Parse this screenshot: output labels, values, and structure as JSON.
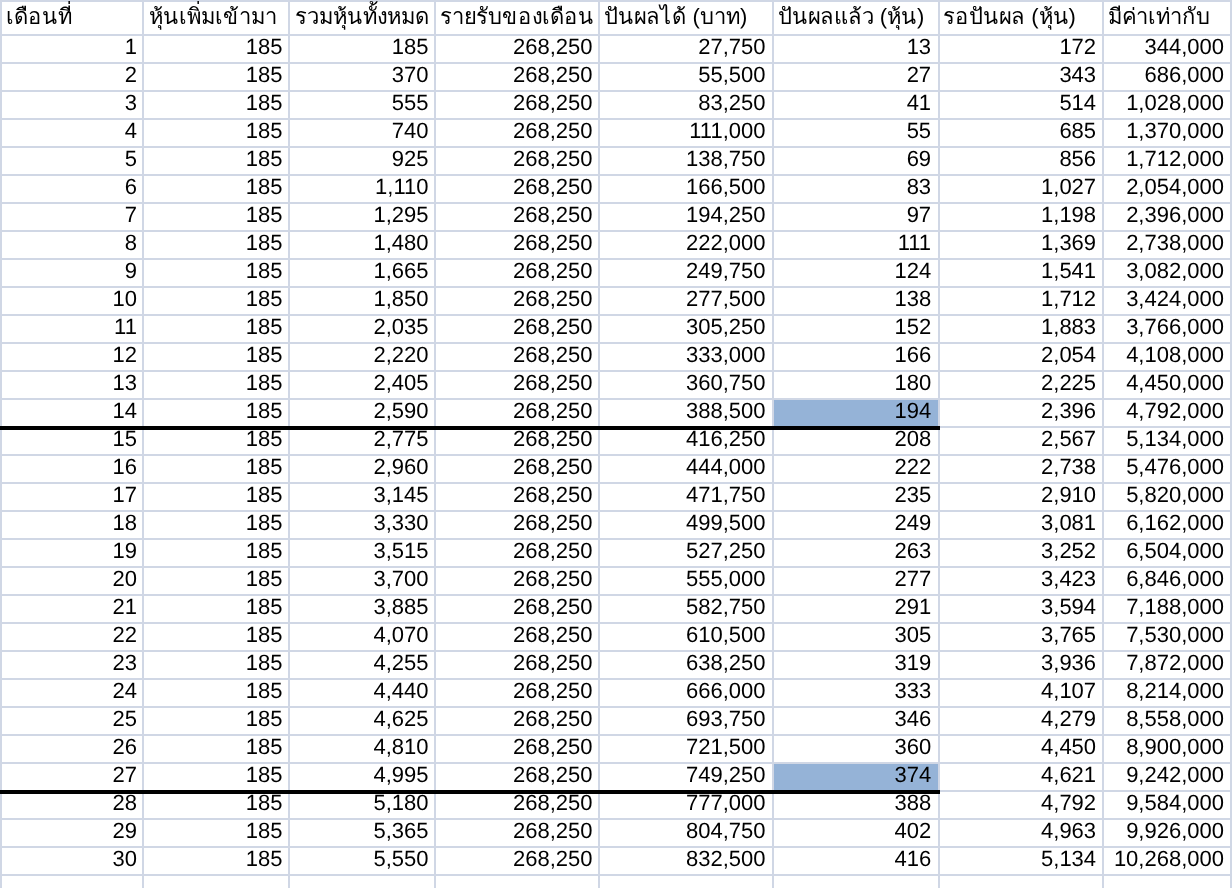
{
  "columns": [
    "เดือนที่",
    "หุ้นเพิ่มเข้ามา",
    "รวมหุ้นทั้งหมด",
    "รายรับของเดือน",
    "ปันผลได้ (บาท)",
    "ปันผลแล้ว (หุ้น)",
    "รอปันผล (หุ้น)",
    "มีค่าเท่ากับ"
  ],
  "rows": [
    {
      "cells": [
        "1",
        "185",
        "185",
        "268,250",
        "27,750",
        "13",
        "172",
        "344,000"
      ],
      "selected": false,
      "thick_border_below": false
    },
    {
      "cells": [
        "2",
        "185",
        "370",
        "268,250",
        "55,500",
        "27",
        "343",
        "686,000"
      ],
      "selected": false,
      "thick_border_below": false
    },
    {
      "cells": [
        "3",
        "185",
        "555",
        "268,250",
        "83,250",
        "41",
        "514",
        "1,028,000"
      ],
      "selected": false,
      "thick_border_below": false
    },
    {
      "cells": [
        "4",
        "185",
        "740",
        "268,250",
        "111,000",
        "55",
        "685",
        "1,370,000"
      ],
      "selected": false,
      "thick_border_below": false
    },
    {
      "cells": [
        "5",
        "185",
        "925",
        "268,250",
        "138,750",
        "69",
        "856",
        "1,712,000"
      ],
      "selected": false,
      "thick_border_below": false
    },
    {
      "cells": [
        "6",
        "185",
        "1,110",
        "268,250",
        "166,500",
        "83",
        "1,027",
        "2,054,000"
      ],
      "selected": false,
      "thick_border_below": false
    },
    {
      "cells": [
        "7",
        "185",
        "1,295",
        "268,250",
        "194,250",
        "97",
        "1,198",
        "2,396,000"
      ],
      "selected": false,
      "thick_border_below": false
    },
    {
      "cells": [
        "8",
        "185",
        "1,480",
        "268,250",
        "222,000",
        "111",
        "1,369",
        "2,738,000"
      ],
      "selected": false,
      "thick_border_below": false
    },
    {
      "cells": [
        "9",
        "185",
        "1,665",
        "268,250",
        "249,750",
        "124",
        "1,541",
        "3,082,000"
      ],
      "selected": false,
      "thick_border_below": false
    },
    {
      "cells": [
        "10",
        "185",
        "1,850",
        "268,250",
        "277,500",
        "138",
        "1,712",
        "3,424,000"
      ],
      "selected": false,
      "thick_border_below": false
    },
    {
      "cells": [
        "11",
        "185",
        "2,035",
        "268,250",
        "305,250",
        "152",
        "1,883",
        "3,766,000"
      ],
      "selected": false,
      "thick_border_below": false
    },
    {
      "cells": [
        "12",
        "185",
        "2,220",
        "268,250",
        "333,000",
        "166",
        "2,054",
        "4,108,000"
      ],
      "selected": false,
      "thick_border_below": false
    },
    {
      "cells": [
        "13",
        "185",
        "2,405",
        "268,250",
        "360,750",
        "180",
        "2,225",
        "4,450,000"
      ],
      "selected": false,
      "thick_border_below": false
    },
    {
      "cells": [
        "14",
        "185",
        "2,590",
        "268,250",
        "388,500",
        "194",
        "2,396",
        "4,792,000"
      ],
      "selected": true,
      "thick_border_below": true
    },
    {
      "cells": [
        "15",
        "185",
        "2,775",
        "268,250",
        "416,250",
        "208",
        "2,567",
        "5,134,000"
      ],
      "selected": false,
      "thick_border_below": false
    },
    {
      "cells": [
        "16",
        "185",
        "2,960",
        "268,250",
        "444,000",
        "222",
        "2,738",
        "5,476,000"
      ],
      "selected": false,
      "thick_border_below": false
    },
    {
      "cells": [
        "17",
        "185",
        "3,145",
        "268,250",
        "471,750",
        "235",
        "2,910",
        "5,820,000"
      ],
      "selected": false,
      "thick_border_below": false
    },
    {
      "cells": [
        "18",
        "185",
        "3,330",
        "268,250",
        "499,500",
        "249",
        "3,081",
        "6,162,000"
      ],
      "selected": false,
      "thick_border_below": false
    },
    {
      "cells": [
        "19",
        "185",
        "3,515",
        "268,250",
        "527,250",
        "263",
        "3,252",
        "6,504,000"
      ],
      "selected": false,
      "thick_border_below": false
    },
    {
      "cells": [
        "20",
        "185",
        "3,700",
        "268,250",
        "555,000",
        "277",
        "3,423",
        "6,846,000"
      ],
      "selected": false,
      "thick_border_below": false
    },
    {
      "cells": [
        "21",
        "185",
        "3,885",
        "268,250",
        "582,750",
        "291",
        "3,594",
        "7,188,000"
      ],
      "selected": false,
      "thick_border_below": false
    },
    {
      "cells": [
        "22",
        "185",
        "4,070",
        "268,250",
        "610,500",
        "305",
        "3,765",
        "7,530,000"
      ],
      "selected": false,
      "thick_border_below": false
    },
    {
      "cells": [
        "23",
        "185",
        "4,255",
        "268,250",
        "638,250",
        "319",
        "3,936",
        "7,872,000"
      ],
      "selected": false,
      "thick_border_below": false
    },
    {
      "cells": [
        "24",
        "185",
        "4,440",
        "268,250",
        "666,000",
        "333",
        "4,107",
        "8,214,000"
      ],
      "selected": false,
      "thick_border_below": false
    },
    {
      "cells": [
        "25",
        "185",
        "4,625",
        "268,250",
        "693,750",
        "346",
        "4,279",
        "8,558,000"
      ],
      "selected": false,
      "thick_border_below": false
    },
    {
      "cells": [
        "26",
        "185",
        "4,810",
        "268,250",
        "721,500",
        "360",
        "4,450",
        "8,900,000"
      ],
      "selected": false,
      "thick_border_below": false
    },
    {
      "cells": [
        "27",
        "185",
        "4,995",
        "268,250",
        "749,250",
        "374",
        "4,621",
        "9,242,000"
      ],
      "selected": true,
      "thick_border_below": true
    },
    {
      "cells": [
        "28",
        "185",
        "5,180",
        "268,250",
        "777,000",
        "388",
        "4,792",
        "9,584,000"
      ],
      "selected": false,
      "thick_border_below": false
    },
    {
      "cells": [
        "29",
        "185",
        "5,365",
        "268,250",
        "804,750",
        "402",
        "4,963",
        "9,926,000"
      ],
      "selected": false,
      "thick_border_below": false
    },
    {
      "cells": [
        "30",
        "185",
        "5,550",
        "268,250",
        "832,500",
        "416",
        "5,134",
        "10,268,000"
      ],
      "selected": false,
      "thick_border_below": false
    }
  ]
}
